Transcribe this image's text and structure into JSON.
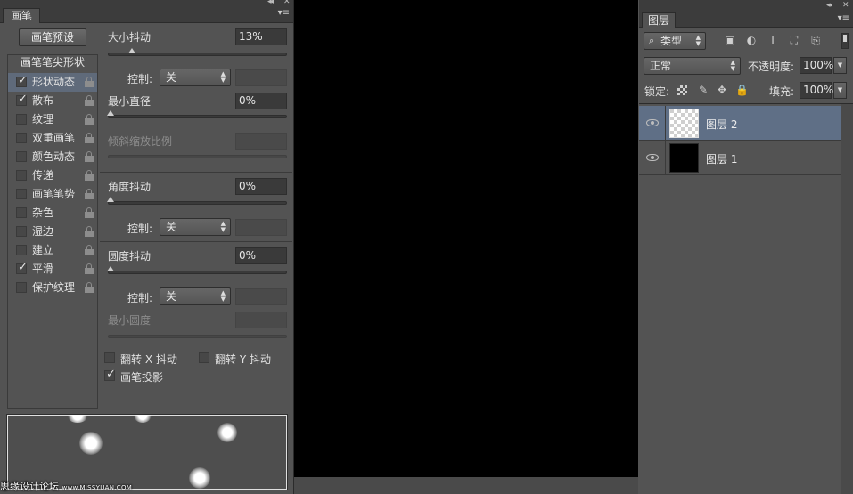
{
  "brush_panel": {
    "tab_label": "画笔",
    "collapse_glyph": "◂◂",
    "close_glyph": "✕",
    "menu_glyph": "▾≡",
    "presets_button": "画笔预设",
    "tip_shape_header": "画笔笔尖形状",
    "options": [
      {
        "label": "形状动态",
        "checked": "✓",
        "selected": true
      },
      {
        "label": "散布",
        "checked": "✓"
      },
      {
        "label": "纹理",
        "checked": ""
      },
      {
        "label": "双重画笔",
        "checked": ""
      },
      {
        "label": "颜色动态",
        "checked": ""
      },
      {
        "label": "传递",
        "checked": ""
      },
      {
        "label": "画笔笔势",
        "checked": ""
      },
      {
        "label": "杂色",
        "checked": ""
      },
      {
        "label": "湿边",
        "checked": ""
      },
      {
        "label": "建立",
        "checked": ""
      },
      {
        "label": "平滑",
        "checked": "✓"
      },
      {
        "label": "保护纹理",
        "checked": ""
      }
    ],
    "size_jitter": {
      "label": "大小抖动",
      "value": "13%",
      "fraction": 0.13
    },
    "control_label": "控制:",
    "control_value": "关",
    "min_diameter": {
      "label": "最小直径",
      "value": "0%"
    },
    "tilt_scale": {
      "label": "倾斜缩放比例"
    },
    "angle_jitter": {
      "label": "角度抖动",
      "value": "0%"
    },
    "roundness_jitter": {
      "label": "圆度抖动",
      "value": "0%"
    },
    "min_roundness": {
      "label": "最小圆度"
    },
    "flip_x": {
      "label": "翻转 X 抖动",
      "checked": ""
    },
    "flip_y": {
      "label": "翻转 Y 抖动",
      "checked": ""
    },
    "brush_projection": {
      "label": "画笔投影",
      "checked": "✓"
    },
    "watermark": {
      "text": "思缘设计论坛",
      "url": "www.MISSYUAN.COM"
    }
  },
  "layers_panel": {
    "collapse_glyph": "◂◂",
    "close_glyph": "✕",
    "menu_glyph": "▾≡",
    "tab_label": "图层",
    "filter_icon": "⌕",
    "filter_label": "类型",
    "filter_icons": {
      "image": "▣",
      "adjust": "◐",
      "type": "T",
      "shape": "⛶",
      "smart": "⎘"
    },
    "blend_mode": "正常",
    "opacity_label": "不透明度:",
    "opacity_value": "100%",
    "lock_label": "锁定:",
    "lock_icons": {
      "brush": "✎",
      "move": "✥",
      "all": "🔒"
    },
    "fill_label": "填充:",
    "fill_value": "100%",
    "layers": [
      {
        "name": "图层 2",
        "selected": true,
        "thumb": "transparent"
      },
      {
        "name": "图层 1",
        "selected": false,
        "thumb": "black"
      }
    ]
  },
  "colors": {
    "panel_bg": "#535353",
    "selection": "#5f6f86",
    "canvas": "#000000"
  }
}
